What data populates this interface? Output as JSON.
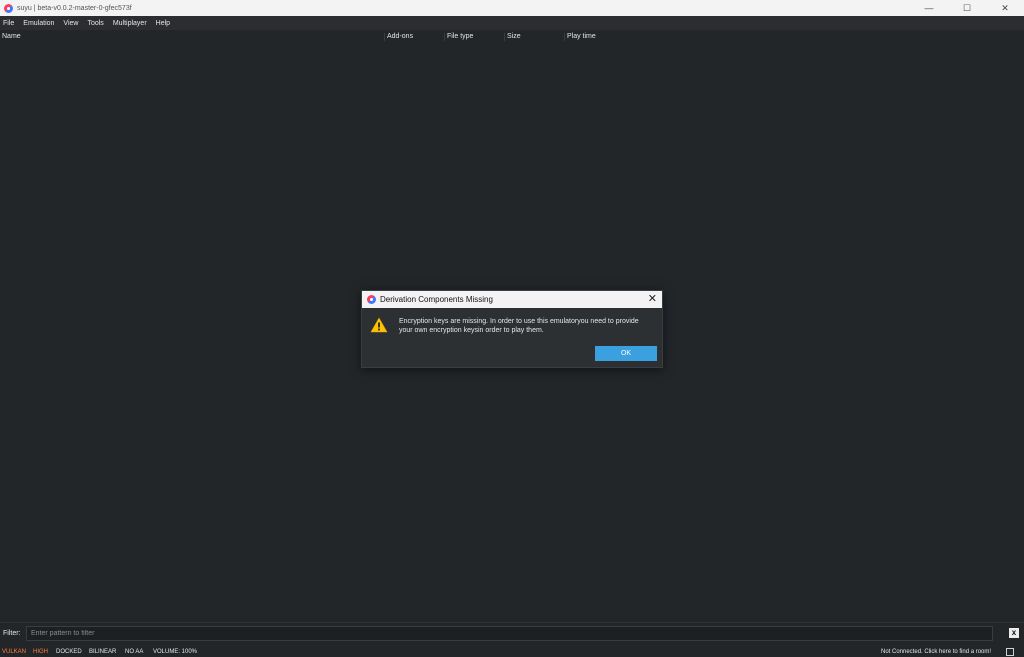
{
  "window": {
    "title": "suyu | beta-v0.0.2-master-0-gfec573f",
    "minimize_glyph": "—",
    "maximize_glyph": "☐",
    "close_glyph": "✕"
  },
  "menu": [
    "File",
    "Emulation",
    "View",
    "Tools",
    "Multiplayer",
    "Help"
  ],
  "game_list": {
    "columns": [
      "Name",
      "Add-ons",
      "File type",
      "Size",
      "Play time"
    ],
    "rows": []
  },
  "filter": {
    "label": "Filter:",
    "placeholder": "Enter pattern to filter",
    "clear_label": "x"
  },
  "status": {
    "renderer": "VULKAN",
    "accuracy": "HIGH",
    "mode": "DOCKED",
    "filter": "BILINEAR",
    "aa": "NO AA",
    "volume": "VOLUME: 100%",
    "network": "Not Connected. Click here to find a room!"
  },
  "dialog": {
    "title": "Derivation Components Missing",
    "close_glyph": "✕",
    "message_line1": "Encryption keys are missing. In order to use this emulatoryou need to provide",
    "message_line2": "your own encryption keysin order to play them.",
    "ok_label": "OK"
  },
  "colors": {
    "background": "#222629",
    "accent": "#3aa0e0",
    "warning": "#ffc107",
    "status_orange": "#ff7f3a"
  }
}
